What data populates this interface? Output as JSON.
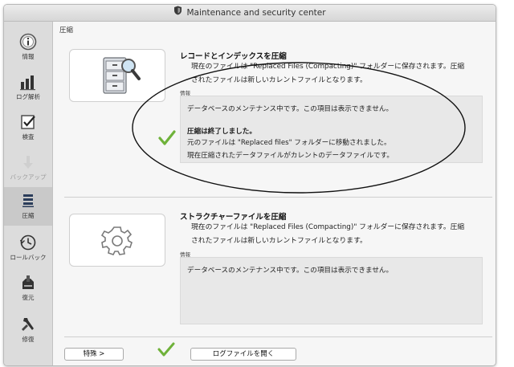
{
  "window": {
    "title": "Maintenance and security center"
  },
  "sidebar": {
    "items": [
      {
        "label": "情報",
        "icon": "info-icon",
        "state": "normal"
      },
      {
        "label": "ログ解析",
        "icon": "log-analysis-icon",
        "state": "normal"
      },
      {
        "label": "検査",
        "icon": "checklist-icon",
        "state": "normal"
      },
      {
        "label": "バックアップ",
        "icon": "backup-icon",
        "state": "disabled"
      },
      {
        "label": "圧縮",
        "icon": "compact-icon",
        "state": "active"
      },
      {
        "label": "ロールバック",
        "icon": "rollback-icon",
        "state": "normal"
      },
      {
        "label": "復元",
        "icon": "restore-icon",
        "state": "normal"
      },
      {
        "label": "修復",
        "icon": "repair-icon",
        "state": "normal"
      }
    ]
  },
  "main": {
    "section_title": "圧縮",
    "records": {
      "heading": "レコードとインデックスを圧縮",
      "desc1": "現在のファイルは \"Replaced Files (Compacting)\" フォルダーに保存されます。圧縮",
      "desc2": "されたファイルは新しいカレントファイルとなります。",
      "info_label": "情報",
      "info_line1": "データベースのメンテナンス中です。この項目は表示できません。",
      "info_line2": "圧縮は終了しました。",
      "info_line3": "元のファイルは \"Replaced files\" フォルダーに移動されました。",
      "info_line4": "現在圧縮されたデータファイルがカレントのデータファイルです。"
    },
    "structure": {
      "heading": "ストラクチャーファイルを圧縮",
      "desc1": "現在のファイルは \"Replaced Files (Compacting)\" フォルダーに保存されます。圧縮",
      "desc2": "されたファイルは新しいカレントファイルとなります。",
      "info_label": "情報",
      "info_line1": "データベースのメンテナンス中です。この項目は表示できません。"
    },
    "footer": {
      "special_button": "特殊 >",
      "open_log_button": "ログファイルを開く"
    }
  },
  "colors": {
    "check_green": "#6fb23a",
    "sidebar_bg": "#dcdcdc",
    "info_bg": "#e8e8e8"
  }
}
